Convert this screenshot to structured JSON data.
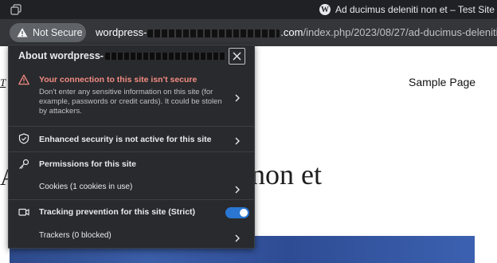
{
  "tab": {
    "title": "Ad ducimus deleniti non et – Test Site 1",
    "favicon": "wordpress-icon"
  },
  "toolbar": {
    "security_chip": "Not Secure",
    "url_host_start": "wordpress-",
    "url_host_end": ".com",
    "url_path": "/index.php/2023/08/27/ad-ducimus-deleniti-no"
  },
  "page": {
    "site_title_fragment": "T",
    "nav_link": "Sample Page",
    "headline_initial": "A",
    "headline_fragment": "i non et"
  },
  "popup": {
    "title_prefix": "About wordpress-",
    "warning": {
      "title": "Your connection to this site isn't secure",
      "description": "Don't enter any sensitive information on this site (for example, passwords or credit cards). It could be stolen by attackers."
    },
    "enhanced_security": "Enhanced security is not active for this site",
    "permissions": "Permissions for this site",
    "cookies": "Cookies (1 cookies in use)",
    "tracking": "Tracking prevention for this site (Strict)",
    "tracking_enabled": true,
    "trackers": "Trackers (0 blocked)"
  },
  "colors": {
    "warning_text": "#f28b82",
    "toggle_on": "#2a76d2",
    "popup_bg": "#292a2d"
  }
}
